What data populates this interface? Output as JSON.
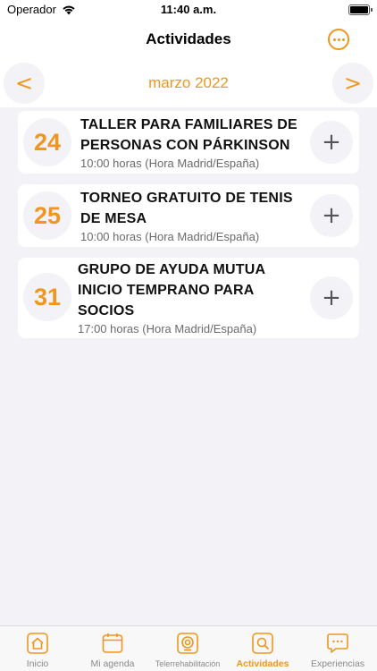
{
  "status_bar": {
    "carrier": "Operador",
    "time": "11:40 a.m."
  },
  "header": {
    "title": "Actividades",
    "more_icon": "ellipsis-circle-icon"
  },
  "month_selector": {
    "label": "marzo 2022",
    "prev_symbol": "<",
    "next_symbol": ">"
  },
  "events": [
    {
      "day": "24",
      "title": "TALLER PARA FAMILIARES DE PERSONAS CON PÁRKINSON",
      "time": "10:00 horas (Hora Madrid/España)"
    },
    {
      "day": "25",
      "title": "TORNEO GRATUITO DE TENIS DE MESA",
      "time": "10:00 horas (Hora Madrid/España)"
    },
    {
      "day": "31",
      "title": "GRUPO DE AYUDA MUTUA INICIO TEMPRANO PARA SOCIOS",
      "time": "17:00 horas (Hora Madrid/España)"
    }
  ],
  "add_symbol": "+",
  "tab_bar": {
    "tabs": [
      {
        "label": "Inicio",
        "icon": "home-icon"
      },
      {
        "label": "Mi agenda",
        "icon": "calendar-icon"
      },
      {
        "label": "Telerrehabilitación",
        "icon": "webcam-icon"
      },
      {
        "label": "Actividades",
        "icon": "search-icon",
        "active": true
      },
      {
        "label": "Experiencias",
        "icon": "chat-bubble-icon"
      }
    ]
  },
  "colors": {
    "accent": "#f0961c",
    "background": "#f2f2f7",
    "inactive_tab": "#8a8a8a"
  }
}
